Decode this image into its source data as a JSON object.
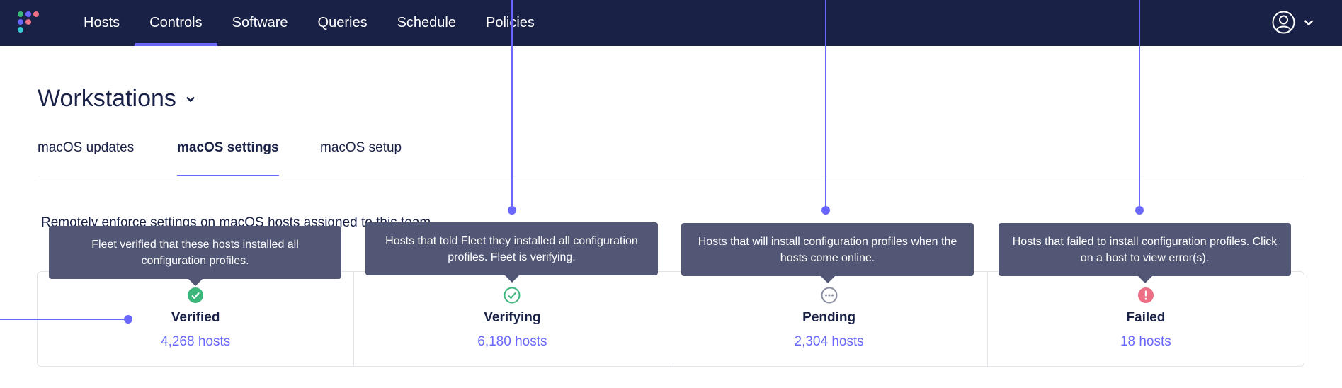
{
  "nav": {
    "items": [
      {
        "label": "Hosts"
      },
      {
        "label": "Controls"
      },
      {
        "label": "Software"
      },
      {
        "label": "Queries"
      },
      {
        "label": "Schedule"
      },
      {
        "label": "Policies"
      }
    ],
    "active": "Controls"
  },
  "team": {
    "name": "Workstations"
  },
  "tabs": [
    {
      "label": "macOS updates"
    },
    {
      "label": "macOS settings"
    },
    {
      "label": "macOS setup"
    }
  ],
  "active_tab": "macOS settings",
  "description": "Remotely enforce settings on macOS hosts assigned to this team.",
  "statuses": [
    {
      "label": "Verified",
      "count": "4,268 hosts",
      "tooltip": "Fleet verified that these hosts installed all configuration profiles.",
      "icon": "check-filled-icon",
      "color": "#3db67b"
    },
    {
      "label": "Verifying",
      "count": "6,180 hosts",
      "tooltip": "Hosts that told Fleet they installed all configuration profiles. Fleet is verifying.",
      "icon": "check-outline-icon",
      "color": "#3db67b"
    },
    {
      "label": "Pending",
      "count": "2,304 hosts",
      "tooltip": "Hosts that will install configuration profiles when the hosts come online.",
      "icon": "pending-icon",
      "color": "#8b8fa2"
    },
    {
      "label": "Failed",
      "count": "18 hosts",
      "tooltip": "Hosts that failed to install configuration profiles. Click on a host to view error(s).",
      "icon": "error-icon",
      "color": "#ed6e85"
    }
  ],
  "colors": {
    "nav_bg": "#192147",
    "accent": "#6a67fe",
    "tooltip_bg": "#515774",
    "text": "#192147"
  }
}
